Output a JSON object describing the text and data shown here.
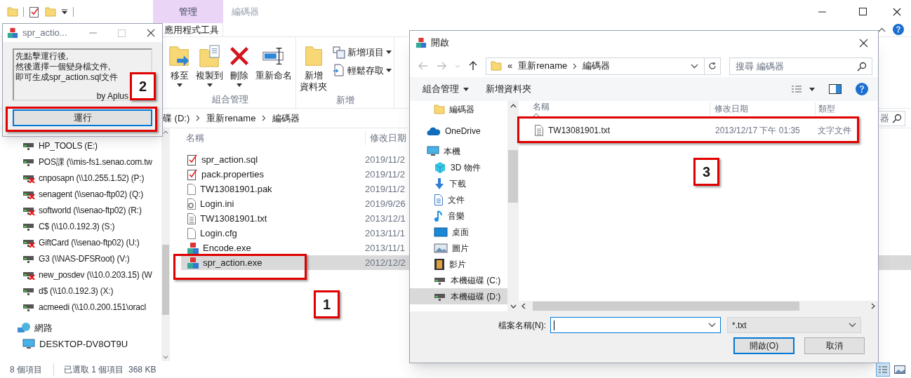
{
  "explorer": {
    "context_tab": {
      "header": "管理",
      "label": "應用程式工具"
    },
    "title": "編碼器",
    "ribbon_groups": [
      {
        "label": "組合管理",
        "buttons": [
          {
            "kind": "move",
            "lines": [
              "移至"
            ],
            "dropdown": true
          },
          {
            "kind": "copy",
            "lines": [
              "複製到"
            ],
            "dropdown": true
          },
          {
            "kind": "delete",
            "lines": [
              "刪除"
            ],
            "dropdown": true
          },
          {
            "kind": "rename",
            "lines": [
              "重新命名"
            ],
            "dropdown": false
          }
        ]
      },
      {
        "label": "新增",
        "buttons": [
          {
            "kind": "new-folder",
            "lines": [
              "新增",
              "資料夾"
            ],
            "dropdown": false
          }
        ],
        "small_buttons": [
          {
            "kind": "new-item",
            "label": "新增項目",
            "dropdown": true
          },
          {
            "kind": "easy-access",
            "label": "輕鬆存取",
            "dropdown": true
          }
        ]
      }
    ],
    "address": [
      "碟 (D:)",
      "重新rename",
      "編碼器"
    ],
    "search_text": "器",
    "nav_items": [
      {
        "kind": "drive",
        "label": "HP_TOOLS (E:)",
        "disconnected": false
      },
      {
        "kind": "drive",
        "label": "POS課 (\\\\mis-fs1.senao.com.tw",
        "disconnected": false
      },
      {
        "kind": "drive",
        "label": "cnposapn (\\\\10.255.1.52) (P:)",
        "disconnected": true
      },
      {
        "kind": "drive",
        "label": "senagent (\\\\senao-ftp02) (Q:)",
        "disconnected": true
      },
      {
        "kind": "drive",
        "label": "softworld (\\\\senao-ftp02) (R:)",
        "disconnected": true
      },
      {
        "kind": "drive",
        "label": "C$ (\\\\10.0.192.3) (S:)",
        "disconnected": false
      },
      {
        "kind": "drive",
        "label": "GiftCard (\\\\senao-ftp02) (U:)",
        "disconnected": true
      },
      {
        "kind": "drive",
        "label": "G3 (\\\\NAS-DFSRoot) (V:)",
        "disconnected": false
      },
      {
        "kind": "drive",
        "label": "new_posdev (\\\\10.0.203.15) (W",
        "disconnected": true
      },
      {
        "kind": "drive",
        "label": "d$ (\\\\10.0.192.3) (X:)",
        "disconnected": false
      },
      {
        "kind": "drive",
        "label": "acmeedi (\\\\10.0.200.151\\oracl",
        "disconnected": false
      },
      {
        "kind": "network",
        "label": "網路",
        "children": [
          {
            "kind": "computer",
            "label": "DESKTOP-DV8OT9U"
          }
        ]
      }
    ],
    "columns": [
      "名稱",
      "修改日期"
    ],
    "files": [
      {
        "kind": "script",
        "name": "spr_action.sql",
        "modified": "2019/11/2",
        "selected": false
      },
      {
        "kind": "script",
        "name": "pack.properties",
        "modified": "2019/11/2",
        "selected": false
      },
      {
        "kind": "blank",
        "name": "TW13081901.pak",
        "modified": "2019/11/2",
        "selected": false
      },
      {
        "kind": "settings",
        "name": "Login.ini",
        "modified": "2019/9/26",
        "selected": false
      },
      {
        "kind": "text",
        "name": "TW13081901.txt",
        "modified": "2013/12/1",
        "selected": false
      },
      {
        "kind": "blank",
        "name": "Login.cfg",
        "modified": "2013/11/1",
        "selected": false
      },
      {
        "kind": "app",
        "name": "Encode.exe",
        "modified": "2013/11/1",
        "selected": false
      },
      {
        "kind": "app",
        "name": "spr_action.exe",
        "modified": "2012/12/2",
        "selected": true
      }
    ],
    "status": [
      "8 個項目",
      "已選取 1 個項目  368 KB"
    ]
  },
  "action_window": {
    "title": "spr_actio...",
    "message": [
      "先點擊運行後,",
      "然後選擇一個變身檔文件,",
      "即可生成spr_action.sql文件"
    ],
    "signature": "by Aplus",
    "button": "運行"
  },
  "open_dialog": {
    "title": "開啟",
    "address_prefix": "«",
    "address": [
      "重新rename",
      "編碼器"
    ],
    "search": {
      "placeholder": "搜尋 編碼器"
    },
    "toolbar": [
      {
        "label": "組合管理",
        "dropdown": true
      },
      {
        "label": "新增資料夾",
        "dropdown": false
      }
    ],
    "nav_items": [
      {
        "kind": "folder",
        "label": "編碼器",
        "selected": false
      },
      {
        "kind": "cloud",
        "label": "OneDrive",
        "selected": false
      },
      {
        "kind": "computer",
        "label": "本機",
        "selected": false,
        "children": [
          {
            "kind": "cube",
            "label": "3D 物件",
            "selected": false
          },
          {
            "kind": "download",
            "label": "下載",
            "selected": false
          },
          {
            "kind": "document",
            "label": "文件",
            "selected": false
          },
          {
            "kind": "music",
            "label": "音樂",
            "selected": false
          },
          {
            "kind": "desktop",
            "label": "桌面",
            "selected": false
          },
          {
            "kind": "picture",
            "label": "圖片",
            "selected": false
          },
          {
            "kind": "video",
            "label": "影片",
            "selected": false
          },
          {
            "kind": "drive",
            "label": "本機磁碟 (C:)",
            "selected": false
          },
          {
            "kind": "drive",
            "label": "本機磁碟 (D:)",
            "selected": true
          }
        ]
      }
    ],
    "columns": [
      "名稱",
      "修改日期",
      "類型"
    ],
    "files": [
      {
        "kind": "text",
        "name": "TW13081901.txt",
        "modified": "2013/12/17 下午 01:35",
        "type": "文字文件"
      }
    ],
    "filename_label": "檔案名稱(N):",
    "filter": "*.txt",
    "buttons": [
      "開啟(O)",
      "取消"
    ]
  },
  "callouts": [
    "1",
    "2",
    "3"
  ]
}
